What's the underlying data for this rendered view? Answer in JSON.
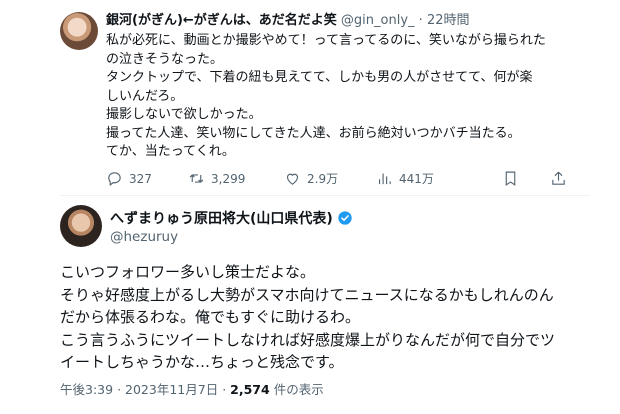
{
  "tweet1": {
    "display_name": "銀河(がぎん)←がぎんは、あだ名だよ笑",
    "handle": "@gin_only_",
    "separator": "·",
    "time": "22時間",
    "lines": [
      "私が必死に、動画とか撮影やめて！って言ってるのに、笑いながら撮られた",
      "の泣きそうなった。",
      "タンクトップで、下着の紐も見えてて、しかも男の人がさせてて、何が楽",
      "しいんだろ。",
      "撮影しないで欲しかった。",
      "撮ってた人達、笑い物にしてきた人達、お前ら絶対いつかバチ当たる。",
      "てか、当たってくれ。"
    ],
    "actions": {
      "replies": "327",
      "retweets": "3,299",
      "likes": "2.9万",
      "views": "441万"
    }
  },
  "tweet2": {
    "display_name": "へずまりゅう原田将大(山口県代表)",
    "handle": "@hezuruy",
    "lines": [
      "こいつフォロワー多いし策士だよな。",
      "そりゃ好感度上がるし大勢がスマホ向けてニュースになるかもしれんのん",
      "だから体張るわな。俺でもすぐに助けるわ。",
      "こう言うふうにツイートしなければ好感度爆上がりなんだが何で自分でツ",
      "イートしちゃうかな…ちょっと残念です。"
    ],
    "time": "午後3:39",
    "dot": "·",
    "date": "2023年11月7日",
    "dot2": "·",
    "view_count": "2,574",
    "view_label": "件の表示"
  },
  "colors": {
    "text": "#0f1419",
    "muted": "#536471",
    "verified": "#1d9bf0"
  },
  "icons": [
    "reply-icon",
    "retweet-icon",
    "like-icon",
    "views-icon",
    "bookmark-icon",
    "share-icon",
    "verified-badge-icon"
  ]
}
